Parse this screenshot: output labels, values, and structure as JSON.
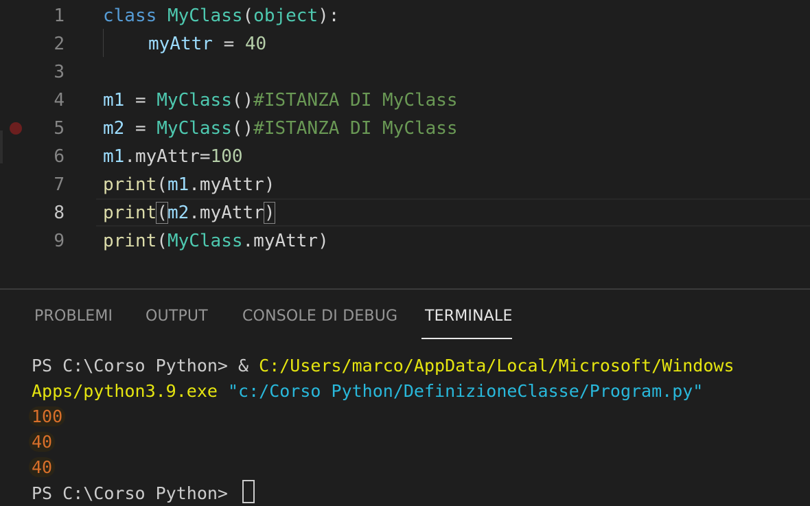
{
  "editor": {
    "lines": [
      {
        "num": "1"
      },
      {
        "num": "2"
      },
      {
        "num": "3"
      },
      {
        "num": "4"
      },
      {
        "num": "5"
      },
      {
        "num": "6"
      },
      {
        "num": "7"
      },
      {
        "num": "8"
      },
      {
        "num": "9"
      }
    ],
    "current_line": "8",
    "breakpoint_line": "5",
    "tokens": {
      "l1": [
        "class",
        " ",
        "MyClass",
        "(",
        "object",
        "):"
      ],
      "l2": [
        "myAttr",
        " = ",
        "40"
      ],
      "l4": [
        "m1",
        " = ",
        "MyClass",
        "()",
        "#ISTANZA DI MyClass"
      ],
      "l5": [
        "m2",
        " = ",
        "MyClass",
        "()",
        "#ISTANZA DI MyClass"
      ],
      "l6": [
        "m1",
        ".myAttr=",
        "100"
      ],
      "l7": [
        "print",
        "(",
        "m1",
        ".myAttr)"
      ],
      "l8": [
        "print",
        "(",
        "m2",
        ".myAttr",
        ")"
      ],
      "l9": [
        "print",
        "(",
        "MyClass",
        ".myAttr)"
      ]
    }
  },
  "panel": {
    "tabs": [
      "PROBLEMI",
      "OUTPUT",
      "CONSOLE DI DEBUG",
      "TERMINALE"
    ],
    "active_tab": "TERMINALE"
  },
  "terminal": {
    "prompt1": "PS C:\\Corso Python> & ",
    "exe_path_1": "C:/Users/marco/AppData/Local/Microsoft/Windows",
    "exe_path_2": "Apps/python3.9.exe",
    "script_arg": "\"c:/Corso Python/DefinizioneClasse/Program.py\"",
    "output": [
      "100",
      "40",
      "40"
    ],
    "prompt2": "PS C:\\Corso Python> "
  },
  "colors": {
    "background": "#1e1e1e",
    "keyword": "#569cd6",
    "class": "#4ec9b0",
    "variable": "#9cdcfe",
    "number": "#b5cea8",
    "comment": "#6a9955",
    "function": "#dcdcaa",
    "breakpoint": "#6c1f1f"
  }
}
